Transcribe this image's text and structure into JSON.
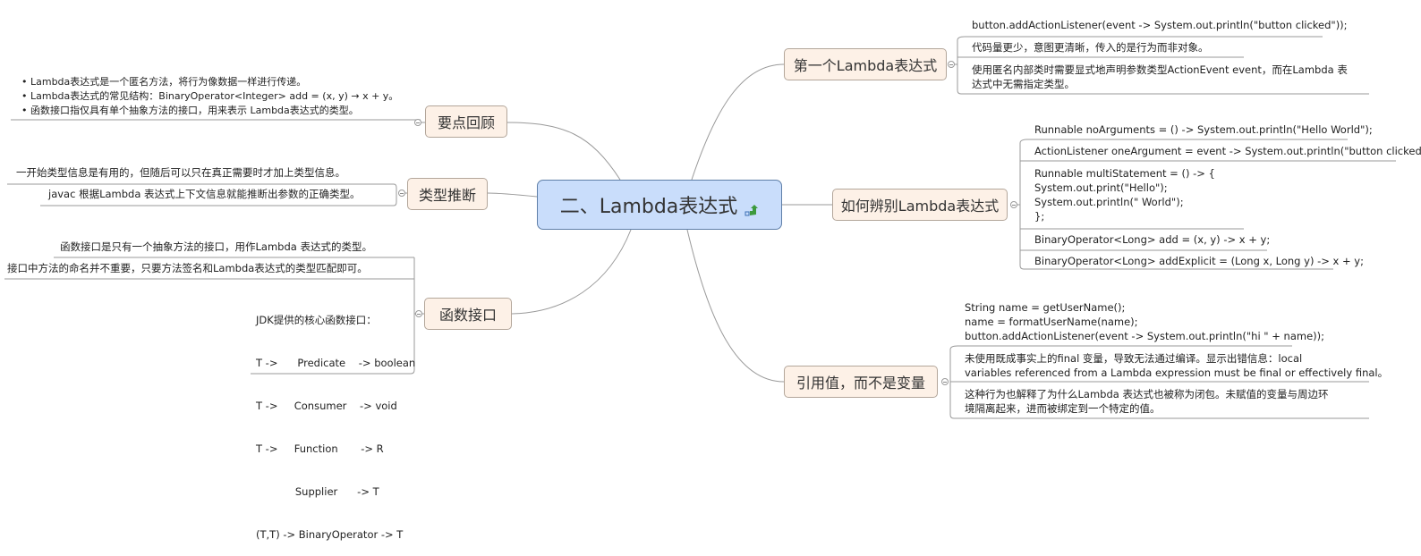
{
  "central": {
    "title": "二、Lambda表达式",
    "icon": "link-arrow-icon"
  },
  "colors": {
    "central_fill": "#c9ddfb",
    "central_border": "#5f7fa8",
    "topic_fill": "#fdf1e7",
    "topic_border": "#b3a69a",
    "line": "#9a9a9a"
  },
  "left_topics": [
    {
      "label": "要点回顾",
      "leaves": [
        "• Lambda表达式是一个匿名方法，将行为像数据一样进行传递。",
        "• Lambda表达式的常见结构：BinaryOperator<Integer> add = (x, y) → x + y。",
        "• 函数接口指仅具有单个抽象方法的接口，用来表示 Lambda表达式的类型。"
      ]
    },
    {
      "label": "类型推断",
      "leaves": [
        "一开始类型信息是有用的，但随后可以只在真正需要时才加上类型信息。",
        "javac 根据Lambda 表达式上下文信息就能推断出参数的正确类型。"
      ]
    },
    {
      "label": "函数接口",
      "leaves": [
        "函数接口是只有一个抽象方法的接口，用作Lambda 表达式的类型。",
        "接口中方法的命名并不重要，只要方法签名和Lambda表达式的类型匹配即可。"
      ],
      "table_lines": [
        "JDK提供的核心函数接口：",
        "T ->      Predicate    -> boolean",
        "T ->     Consumer    -> void",
        "T ->     Function       -> R",
        "            Supplier      -> T",
        "(T,T) -> BinaryOperator -> T"
      ]
    }
  ],
  "right_topics": [
    {
      "label": "第一个Lambda表达式",
      "leaves": [
        "button.addActionListener(event -> System.out.println(\"button clicked\"));",
        "代码量更少，意图更清晰，传入的是行为而非对象。",
        "使用匿名内部类时需要显式地声明参数类型ActionEvent event，而在Lambda 表",
        "达式中无需指定类型。"
      ]
    },
    {
      "label": "如何辨别Lambda表达式",
      "leaves": [
        "Runnable noArguments = () -> System.out.println(\"Hello World\");",
        "ActionListener oneArgument = event -> System.out.println(\"button clicked\");",
        "Runnable multiStatement = () -> {",
        "System.out.print(\"Hello\");",
        "System.out.println(\" World\");",
        "};",
        "BinaryOperator<Long> add = (x, y) -> x + y;",
        "BinaryOperator<Long> addExplicit = (Long x, Long y) -> x + y;"
      ]
    },
    {
      "label": "引用值，而不是变量",
      "leaves": [
        "String name = getUserName();",
        "name = formatUserName(name);",
        "button.addActionListener(event -> System.out.println(\"hi \" + name));",
        "未使用既成事实上的final 变量，导致无法通过编译。显示出错信息：local",
        "variables referenced from a Lambda expression must be final or effectively final。",
        "这种行为也解释了为什么Lambda 表达式也被称为闭包。未赋值的变量与周边环",
        "境隔离起来，进而被绑定到一个特定的值。"
      ]
    }
  ]
}
